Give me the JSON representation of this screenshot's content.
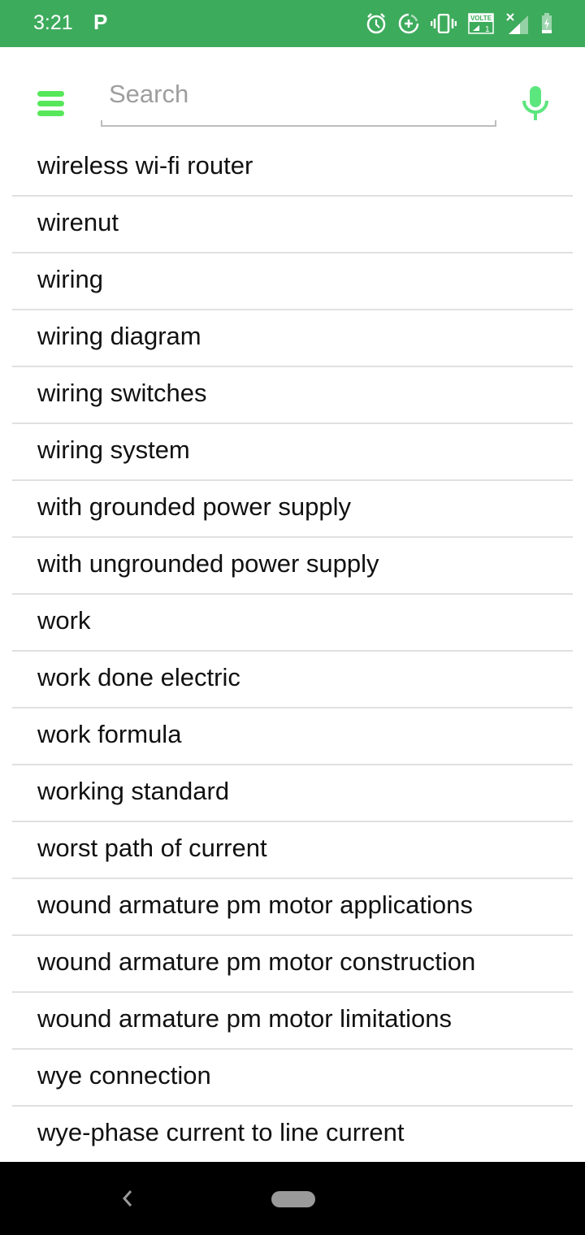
{
  "status_bar": {
    "time": "3:21",
    "app_indicator": "P",
    "icons": [
      "alarm-icon",
      "data-saver-icon",
      "vibrate-icon",
      "volte-icon",
      "signal-icon",
      "battery-charging-icon"
    ],
    "volte_label": "VOLTE",
    "sim_label": "1",
    "background_color": "#3dab5c"
  },
  "header": {
    "menu_icon": "hamburger-menu-icon",
    "search": {
      "placeholder": "Search",
      "value": ""
    },
    "mic_icon": "microphone-icon",
    "accent_color": "#57e75a"
  },
  "list": {
    "items": [
      {
        "label": "wireless wi-fi router"
      },
      {
        "label": "wirenut"
      },
      {
        "label": "wiring"
      },
      {
        "label": "wiring diagram"
      },
      {
        "label": "wiring switches"
      },
      {
        "label": "wiring system"
      },
      {
        "label": "with grounded power supply"
      },
      {
        "label": "with ungrounded power supply"
      },
      {
        "label": "work"
      },
      {
        "label": "work done electric"
      },
      {
        "label": "work formula"
      },
      {
        "label": "working standard"
      },
      {
        "label": "worst path of current"
      },
      {
        "label": "wound armature pm motor applications"
      },
      {
        "label": "wound armature pm motor construction"
      },
      {
        "label": "wound armature pm motor limitations"
      },
      {
        "label": "wye connection"
      },
      {
        "label": "wye-phase current to line current"
      }
    ]
  },
  "nav_bar": {
    "back_icon": "back-chevron-icon",
    "home_icon": "home-pill-icon"
  }
}
